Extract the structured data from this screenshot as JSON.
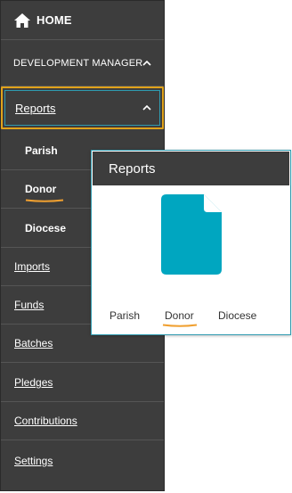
{
  "colors": {
    "sidebar_bg": "#3d3d3d",
    "accent_border": "#e0a21a",
    "teal": "#00a6c0",
    "underline": "#f0a030"
  },
  "sidebar": {
    "home": {
      "label": "HOME",
      "icon": "home-icon"
    },
    "dev_manager": {
      "label": "DEVELOPMENT MANAGER",
      "icon": "chevron-up-icon"
    },
    "reports": {
      "label": "Reports",
      "icon": "chevron-up-icon"
    },
    "sub_items": [
      {
        "label": "Parish"
      },
      {
        "label": "Donor"
      },
      {
        "label": "Diocese"
      }
    ],
    "items": [
      {
        "label": "Imports"
      },
      {
        "label": "Funds"
      },
      {
        "label": "Batches"
      },
      {
        "label": "Pledges"
      },
      {
        "label": "Contributions"
      },
      {
        "label": "Settings"
      }
    ]
  },
  "popup": {
    "title": "Reports",
    "icon": "document-icon",
    "links": [
      {
        "label": "Parish"
      },
      {
        "label": "Donor"
      },
      {
        "label": "Diocese"
      }
    ]
  }
}
